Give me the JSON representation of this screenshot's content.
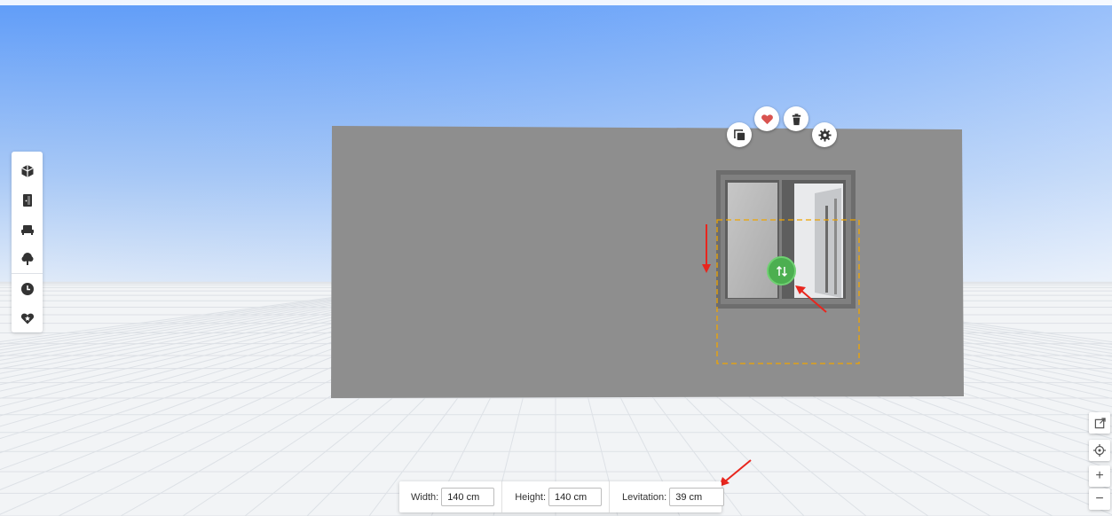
{
  "colors": {
    "sky_top": "#5d9bf9",
    "sky_bottom": "#e3edf9",
    "ground": "#f3f5f7",
    "wall": "#8f8f8f",
    "selection_outline": "#f0a500",
    "handle": "#4caf50",
    "annotation_arrow": "#e8261e",
    "favorite": "#d9534f"
  },
  "sidebar": {
    "items": [
      {
        "name": "3d-view",
        "icon": "cube-icon"
      },
      {
        "name": "doors-windows",
        "icon": "door-icon"
      },
      {
        "name": "furniture",
        "icon": "sofa-icon"
      },
      {
        "name": "outdoor",
        "icon": "tree-icon"
      },
      {
        "name": "history",
        "icon": "clock-icon"
      },
      {
        "name": "favorites",
        "icon": "heart-star-icon"
      }
    ]
  },
  "object_menu": {
    "actions": [
      {
        "name": "copy",
        "icon": "copy-icon"
      },
      {
        "name": "favorite",
        "icon": "heart-icon"
      },
      {
        "name": "delete",
        "icon": "trash-icon"
      },
      {
        "name": "settings",
        "icon": "gear-icon"
      }
    ]
  },
  "move_handle": {
    "icon": "swap-vertical-icon"
  },
  "view_controls": {
    "items": [
      {
        "name": "open-external",
        "icon": "external-link-icon"
      },
      {
        "name": "recenter",
        "icon": "target-icon"
      },
      {
        "name": "zoom-in",
        "label": "+"
      },
      {
        "name": "zoom-out",
        "label": "−"
      }
    ]
  },
  "dimensions": {
    "width_label": "Width:",
    "width_value": "140 cm",
    "height_label": "Height:",
    "height_value": "140 cm",
    "levitation_label": "Levitation:",
    "levitation_value": "39 cm"
  }
}
